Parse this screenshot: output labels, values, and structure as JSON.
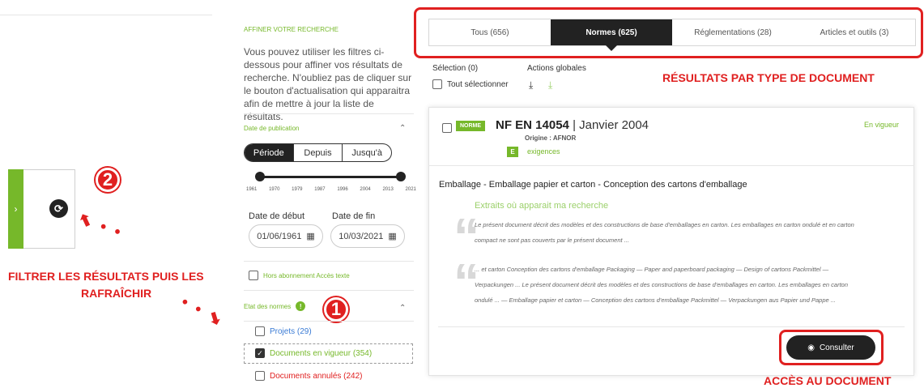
{
  "left_panel": {
    "expand_glyph": "›",
    "refresh_glyph": "⟳",
    "badge_2": "2",
    "badge_1": "1",
    "annotation_filter_line1": "FILTRER LES RÉSULTATS PUIS LES",
    "annotation_filter_line2": "RAFRAÎCHIR"
  },
  "filters": {
    "title": "AFFINER VOTRE RECHERCHE",
    "description": "Vous pouvez utiliser les filtres ci-dessous pour affiner vos résultats de recherche. N'oubliez pas de cliquer sur le bouton d'actualisation qui apparaitra afin de mettre à jour la liste de résultats.",
    "pub_date": {
      "title": "Date de publication",
      "modes": [
        "Période",
        "Depuis",
        "Jusqu'à"
      ],
      "ticks": [
        "1961",
        "1970",
        "1979",
        "1987",
        "1996",
        "2004",
        "2013",
        "2021"
      ],
      "start_label": "Date de début",
      "end_label": "Date de fin",
      "start_value": "01/06/1961",
      "end_value": "10/03/2021"
    },
    "hors_abonnement": "Hors abonnement Accès texte",
    "etat": {
      "title": "Etat des normes",
      "info_glyph": "!",
      "items": [
        {
          "label": "Projets (29)",
          "color": "#3a7bd5",
          "checked": false
        },
        {
          "label": "Documents en vigueur (354)",
          "color": "#76b82a",
          "checked": true
        },
        {
          "label": "Documents annulés (242)",
          "color": "#e02020",
          "checked": false
        }
      ]
    }
  },
  "results": {
    "tabs": [
      {
        "label": "Tous (656)",
        "active": false
      },
      {
        "label": "Normes (625)",
        "active": true
      },
      {
        "label": "Réglementations (28)",
        "active": false
      },
      {
        "label": "Articles et outils (3)",
        "active": false
      }
    ],
    "selection": "Sélection (0)",
    "global_actions": "Actions globales",
    "select_all": "Tout sélectionner",
    "annotation_type": "RÉSULTATS PAR TYPE DE DOCUMENT",
    "annotation_access": "ACCÈS AU DOCUMENT",
    "card": {
      "badge": "NORME",
      "ref": "NF EN 14054",
      "date": "| Janvier 2004",
      "origin": "Origine : AFNOR",
      "req_badge": "E",
      "req_label": "exigences",
      "status": "En vigueur",
      "summary": "Emballage - Emballage papier et carton - Conception des cartons d'emballage",
      "extracts_title": "Extraits où apparait ma recherche",
      "extract1": "Le présent document décrit des modèles et des constructions de base d'emballages en carton. Les emballages en carton ondulé et en carton compact ne sont pas couverts par le présent document ...",
      "extract2": "... et carton Conception des cartons d'emballage Packaging — Paper and paperboard packaging — Design of cartons Packmittel — Verpackungen ... Le présent document décrit des modèles et des constructions de base d'emballages en carton. Les emballages en carton ondulé ... — Emballage papier et carton — Conception des cartons d'emballage Packmittel — Verpackungen aus Papier und Pappe ...",
      "consult": "Consulter"
    }
  }
}
